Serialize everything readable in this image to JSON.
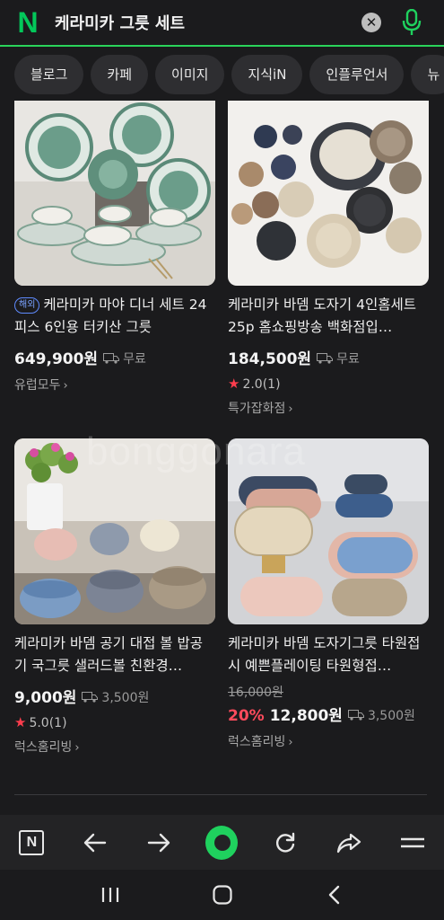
{
  "header": {
    "logo": "N",
    "query": "케라미카 그릇 세트",
    "clear_icon": "close-icon",
    "mic_icon": "microphone-icon"
  },
  "tabs": [
    "블로그",
    "카페",
    "이미지",
    "지식iN",
    "인플루언서",
    "뉴"
  ],
  "products": [
    {
      "badge": "해외",
      "title": "케라미카 마야 디너 세트 24피스 6인용 터키산 그릇",
      "price": "649,900원",
      "shipping": "무료",
      "seller": "유럽모두"
    },
    {
      "title": "케라미카 바뎀 도자기 4인홈세트 25p 홈쇼핑방송 백화점입…",
      "price": "184,500원",
      "shipping": "무료",
      "rating": "2.0",
      "reviews": "(1)",
      "seller": "특가잡화점"
    },
    {
      "title": "케라미카 바뎀 공기 대접 볼 밥공기 국그릇 샐러드볼 친환경…",
      "price": "9,000원",
      "shipping": "3,500원",
      "rating": "5.0",
      "reviews": "(1)",
      "seller": "럭스홈리빙"
    },
    {
      "title": "케라미카 바뎀 도자기그릇 타원접시 예쁜플레이팅 타원형접…",
      "original_price": "16,000원",
      "discount": "20%",
      "price": "12,800원",
      "shipping": "3,500원",
      "seller": "럭스홈리빙"
    }
  ],
  "watermark": "bonggonara",
  "colors": {
    "accent": "#03c75a",
    "discount": "#ff4b5c",
    "star": "#ff3d4d",
    "background": "#1b1b1d"
  },
  "toolbar_icons": [
    "naver-home-icon",
    "back-arrow-icon",
    "forward-arrow-icon",
    "green-dot-icon",
    "refresh-icon",
    "share-icon",
    "menu-icon"
  ],
  "android_nav_icons": [
    "recent-apps-icon",
    "home-icon",
    "back-icon"
  ]
}
